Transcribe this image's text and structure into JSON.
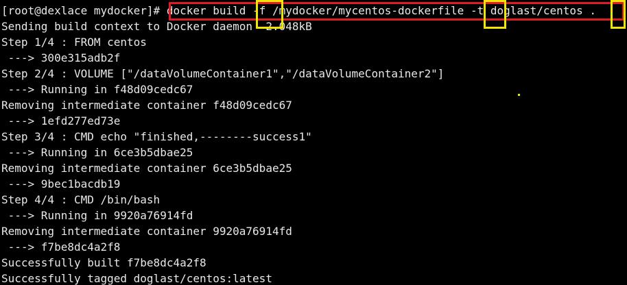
{
  "terminal": {
    "prompt": "[root@dexlace mydocker]#",
    "command": "docker build -f /mydocker/mycentos-dockerfile -t doglast/centos .",
    "output": [
      "Sending build context to Docker daemon  2.048kB",
      "Step 1/4 : FROM centos",
      " ---> 300e315adb2f",
      "Step 2/4 : VOLUME [\"/dataVolumeContainer1\",\"/dataVolumeContainer2\"]",
      " ---> Running in f48d09cedc67",
      "Removing intermediate container f48d09cedc67",
      " ---> 1efd277ed73e",
      "Step 3/4 : CMD echo \"finished,--------success1\"",
      " ---> Running in 6ce3b5dbae25",
      "Removing intermediate container 6ce3b5dbae25",
      " ---> 9bec1bacdb19",
      "Step 4/4 : CMD /bin/bash",
      " ---> Running in 9920a76914fd",
      "Removing intermediate container 9920a76914fd",
      " ---> f7be8dc4a2f8",
      "Successfully built f7be8dc4a2f8",
      "Successfully tagged doglast/centos:latest"
    ]
  },
  "colors": {
    "background": "#000000",
    "text": "#e8e8e8",
    "annotation_red": "#e01b24",
    "annotation_yellow": "#f2e600"
  }
}
